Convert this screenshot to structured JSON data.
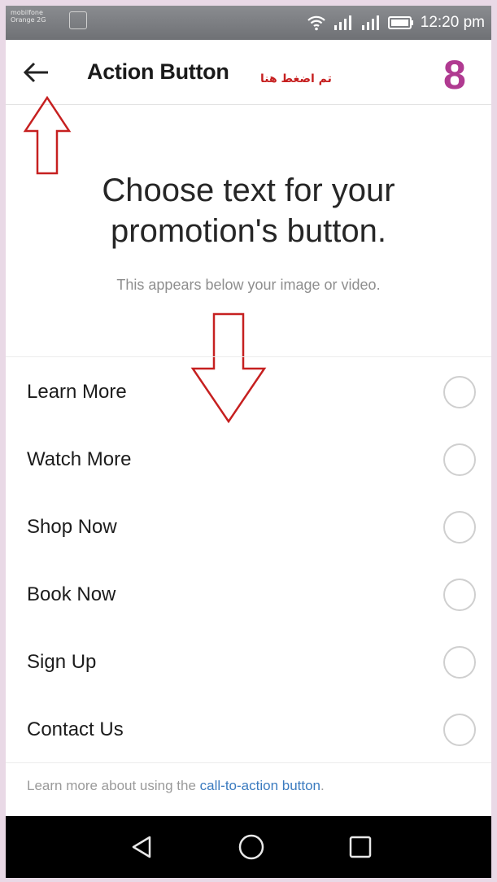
{
  "status_bar": {
    "carrier_line1": "mobilfone",
    "carrier_line2": "Orange 2G",
    "time": "12:20 pm"
  },
  "app_bar": {
    "title": "Action Button",
    "annotation_note": "تم اضغط هنا",
    "step_number": "8"
  },
  "content": {
    "headline_line1": "Choose text for your",
    "headline_line2": "promotion's button.",
    "subline": "This appears below your image or video."
  },
  "options": [
    {
      "label": "Learn More",
      "selected": false
    },
    {
      "label": "Watch More",
      "selected": false
    },
    {
      "label": "Shop Now",
      "selected": false
    },
    {
      "label": "Book Now",
      "selected": false
    },
    {
      "label": "Sign Up",
      "selected": false
    },
    {
      "label": "Contact Us",
      "selected": false
    }
  ],
  "footer": {
    "text": "Learn more about using the ",
    "link": "call-to-action button",
    "suffix": "."
  },
  "colors": {
    "annotation_red": "#c62020",
    "step_magenta": "#b03a91",
    "link_blue": "#3b7bbf"
  },
  "icons": {
    "back": "arrow-left-icon",
    "nav_back": "triangle-back-icon",
    "nav_home": "circle-home-icon",
    "nav_recents": "square-recents-icon"
  }
}
